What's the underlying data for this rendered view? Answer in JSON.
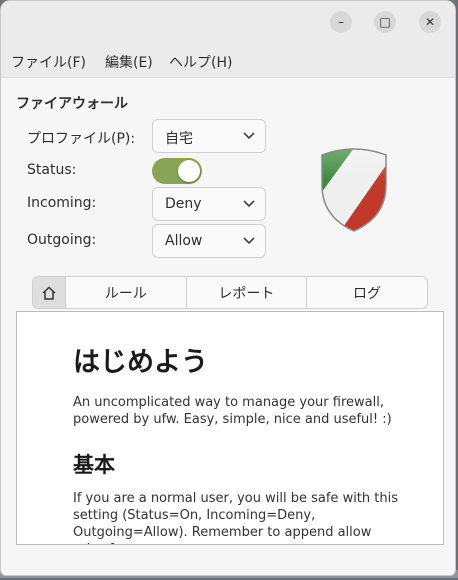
{
  "window": {
    "minimize_glyph": "–",
    "maximize_glyph": "□",
    "close_glyph": "✕"
  },
  "menu": {
    "file": "ファイル(F)",
    "edit": "編集(E)",
    "help": "ヘルプ(H)"
  },
  "firewall": {
    "heading": "ファイアウォール",
    "profile_label": "プロファイル(P):",
    "profile_value": "自宅",
    "status_label": "Status:",
    "status_on": true,
    "incoming_label": "Incoming:",
    "incoming_value": "Deny",
    "outgoing_label": "Outgoing:",
    "outgoing_value": "Allow"
  },
  "tabs": {
    "home_icon": "home-icon",
    "rules": "ルール",
    "report": "レポート",
    "log": "ログ"
  },
  "content": {
    "title": "はじめよう",
    "intro": "An uncomplicated way to manage your firewall, powered by ufw. Easy, simple, nice and useful! :)",
    "basics_title": "基本",
    "basics_text": "If you are a normal user, you will be safe with this setting (Status=On, Incoming=Deny, Outgoing=Allow). Remember to append allow rules for"
  },
  "colors": {
    "toggle_on": "#88a455",
    "shield_green": "#3d8a3d",
    "shield_red": "#c0392b"
  }
}
